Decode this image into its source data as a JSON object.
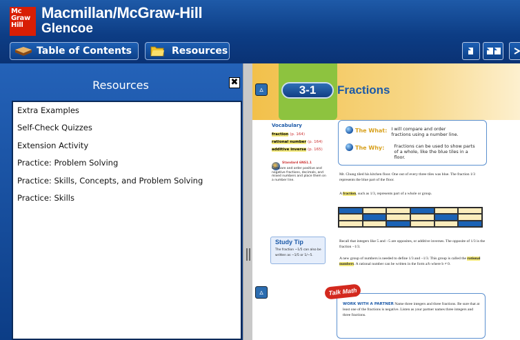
{
  "app": {
    "brand_line1": "Macmillan/McGraw-Hill",
    "brand_line2": "Glencoe",
    "logo_lines": [
      "Mc",
      "Graw",
      "Hill"
    ]
  },
  "toolbar": {
    "toc_label": "Table of Contents",
    "resources_label": "Resources",
    "toc_icon": "open-book-icon",
    "resources_icon": "folder-icon"
  },
  "resources_panel": {
    "title": "Resources",
    "close_label": "✖",
    "items": [
      "Extra Examples",
      "Self-Check Quizzes",
      "Extension Activity",
      "Practice: Problem Solving",
      "Practice: Skills, Concepts, and Problem Solving",
      "Practice: Skills"
    ]
  },
  "page": {
    "lesson_number": "3-1",
    "lesson_title": "Fractions",
    "vocabulary_heading": "Vocabulary",
    "vocabulary": [
      {
        "term": "fraction",
        "ref": "(p. 164)"
      },
      {
        "term": "rational number",
        "ref": "(p. 164)"
      },
      {
        "term": "additive inverse",
        "ref": "(p. 165)"
      }
    ],
    "standard_title": "Standard 6NS1.1",
    "standard_text": "Compare and order positive and negative fractions, decimals, and mixed numbers and place them on a number line.",
    "what_label_prefix": "The ",
    "what_label_word": "What:",
    "what_text": "I will compare and order fractions using a number line.",
    "why_label_prefix": "The ",
    "why_label_word": "Why:",
    "why_text": "Fractions can be used to show parts of a whole, like the blue tiles in a floor.",
    "para1": "Mr. Chung tiled his kitchen floor. One out of every three tiles was blue. The fraction 1/3 represents the blue part of the floor.",
    "para2_prefix": "A ",
    "para2_term": "fraction",
    "para2_suffix": ", such as 1/3, represents part of a whole or group.",
    "grid_pattern": [
      [
        1,
        0,
        0,
        1,
        0,
        0
      ],
      [
        0,
        1,
        0,
        0,
        1,
        0
      ],
      [
        0,
        0,
        1,
        0,
        0,
        1
      ]
    ],
    "study_tip_title": "Study Tip",
    "study_tip_text": "The fraction −1/5 can also be written as −1/5 or 1/−5.",
    "para3": "Recall that integers like 5 and −5 are opposites, or additive inverses. The opposite of 1/3 is the fraction −1/3.",
    "para4_prefix": "A new group of numbers is needed to define 1/3 and −1/3. This group is called the ",
    "para4_term": "rational numbers",
    "para4_suffix": ". A rational number can be written in the form a/b where b ≠ 0.",
    "talk_badge": "Talk Math",
    "talk_heading": "WORK WITH A PARTNER",
    "talk_text": " Name three integers and three fractions. Be sure that at least one of the fractions is negative. Listen as your partner names three integers and three fractions."
  }
}
